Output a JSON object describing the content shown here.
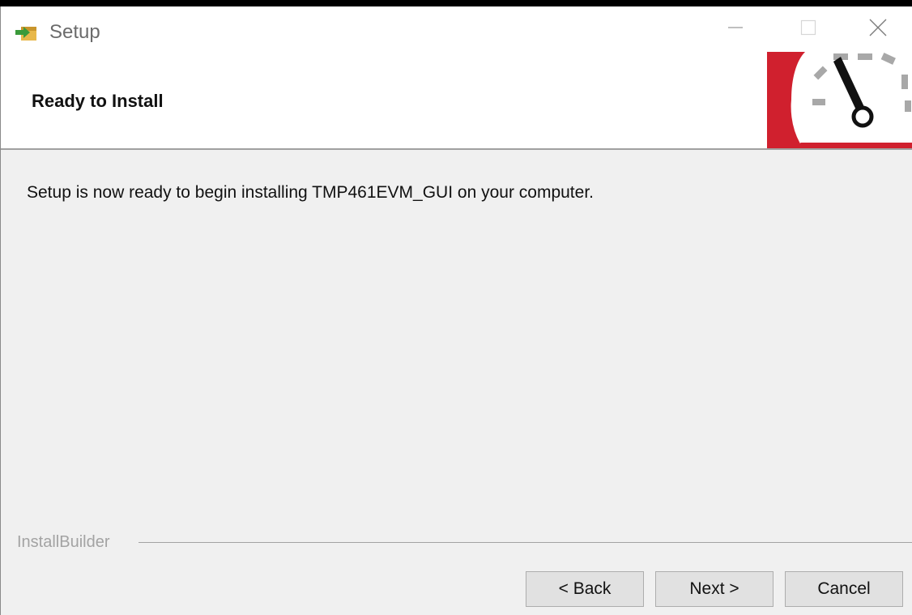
{
  "window": {
    "title": "Setup"
  },
  "header": {
    "title": "Ready to Install",
    "logo_icon": "speedometer-icon",
    "accent_color": "#d0202e"
  },
  "main": {
    "message": "Setup is now ready to begin installing TMP461EVM_GUI on your computer."
  },
  "footer": {
    "brand": "InstallBuilder",
    "buttons": {
      "back": "< Back",
      "next": "Next >",
      "cancel": "Cancel"
    }
  },
  "title_buttons": {
    "minimize_icon": "minimize-icon",
    "maximize_icon": "maximize-icon",
    "close_icon": "close-icon"
  }
}
